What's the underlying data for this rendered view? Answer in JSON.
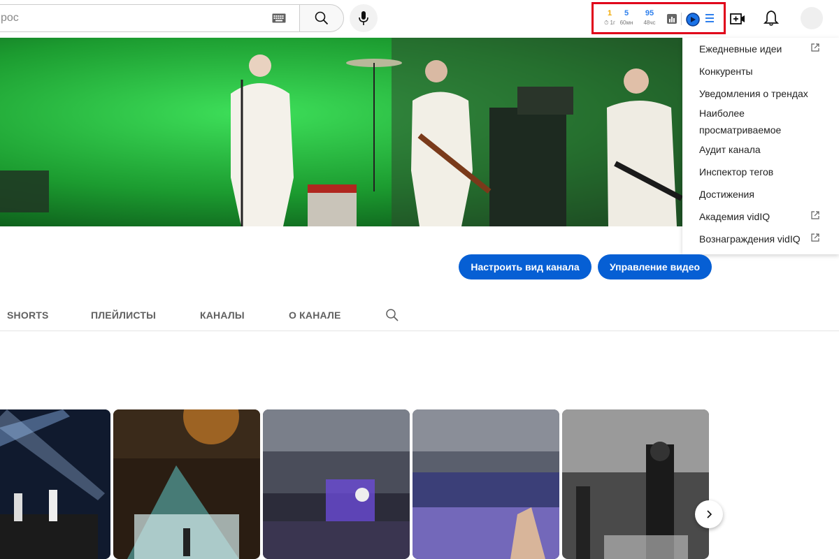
{
  "search": {
    "placeholder": "рос"
  },
  "vidiq": {
    "stats": [
      {
        "value": "1",
        "label": "⏱ 1г"
      },
      {
        "value": "5",
        "label": "60мн"
      },
      {
        "value": "95",
        "label": "48чс"
      }
    ],
    "colors": {
      "highlight": "#e0001a",
      "stat_yellow": "#f2a900",
      "stat_blue": "#2f80ed"
    }
  },
  "dropdown": {
    "items": [
      {
        "label": "Ежедневные идеи",
        "external": true
      },
      {
        "label": "Конкуренты",
        "external": false
      },
      {
        "label": "Уведомления о трендах",
        "external": false
      },
      {
        "label": "Наиболее",
        "external": false
      },
      {
        "label": "просматриваемое",
        "external": false
      },
      {
        "label": "Аудит канала",
        "external": false
      },
      {
        "label": "Инспектор тегов",
        "external": false
      },
      {
        "label": "Достижения",
        "external": false
      },
      {
        "label": "Академия vidIQ",
        "external": true
      },
      {
        "label": "Вознаграждения vidIQ",
        "external": true
      }
    ]
  },
  "actions": {
    "customize_label": "Настроить вид канала",
    "manage_label": "Управление видео",
    "accent": "#065fd4"
  },
  "tabs": [
    {
      "label": "SHORTS"
    },
    {
      "label": "ПЛЕЙЛИСТЫ"
    },
    {
      "label": "КАНАЛЫ"
    },
    {
      "label": "О КАНАЛЕ"
    }
  ],
  "icons": [
    "keyboard-icon",
    "search-icon",
    "mic-icon",
    "chart-icon",
    "vidiq-logo-icon",
    "menu-icon",
    "create-video-icon",
    "bell-icon",
    "external-link-icon",
    "chevron-right-icon"
  ]
}
